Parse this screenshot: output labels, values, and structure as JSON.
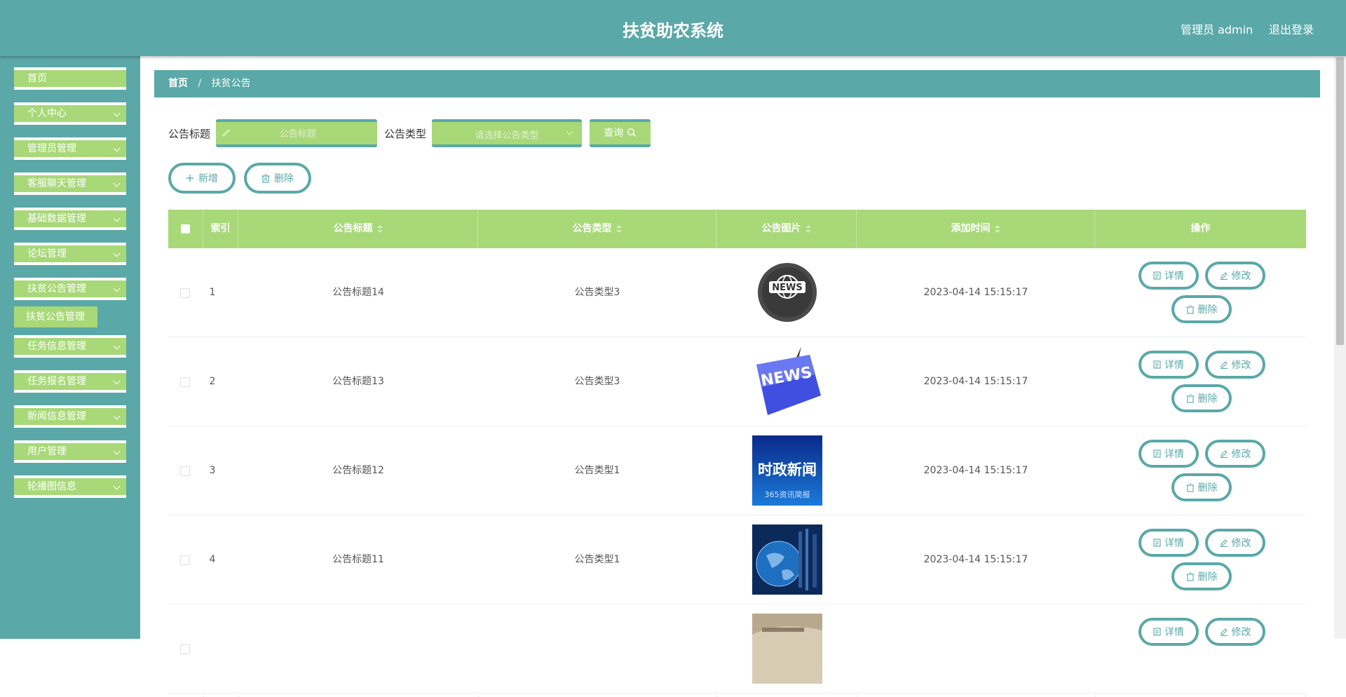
{
  "header": {
    "title": "扶贫助农系统",
    "user": "管理员 admin",
    "logout": "退出登录"
  },
  "sidebar": {
    "items": [
      {
        "label": "首页"
      },
      {
        "label": "个人中心"
      },
      {
        "label": "管理员管理"
      },
      {
        "label": "客服聊天管理"
      },
      {
        "label": "基础数据管理"
      },
      {
        "label": "论坛管理"
      },
      {
        "label": "扶贫公告管理"
      },
      {
        "label": "任务信息管理"
      },
      {
        "label": "任务报名管理"
      },
      {
        "label": "新闻信息管理"
      },
      {
        "label": "用户管理"
      },
      {
        "label": "轮播图信息"
      }
    ],
    "submenu": {
      "label": "扶贫公告管理"
    }
  },
  "breadcrumb": {
    "home": "首页",
    "separator": "/",
    "current": "扶贫公告"
  },
  "search": {
    "title_label": "公告标题",
    "title_placeholder": "公告标题",
    "type_label": "公告类型",
    "type_placeholder": "请选择公告类型",
    "query_label": "查询"
  },
  "actions": {
    "add_label": "新增",
    "delete_label": "删除"
  },
  "table": {
    "columns": [
      "索引",
      "公告标题",
      "公告类型",
      "公告图片",
      "添加时间",
      "操作"
    ],
    "row_actions": {
      "detail": "详情",
      "edit": "修改",
      "delete": "删除"
    },
    "rows": [
      {
        "index": "1",
        "title": "公告标题14",
        "type": "公告类型3",
        "image_text": "NEWS",
        "time": "2023-04-14 15:15:17"
      },
      {
        "index": "2",
        "title": "公告标题13",
        "type": "公告类型3",
        "image_text": "NEWS",
        "time": "2023-04-14 15:15:17"
      },
      {
        "index": "3",
        "title": "公告标题12",
        "type": "公告类型1",
        "image_text": "时政新闻",
        "image_subtext": "365资讯简报",
        "time": "2023-04-14 15:15:17"
      },
      {
        "index": "4",
        "title": "公告标题11",
        "type": "公告类型1",
        "time": "2023-04-14 15:15:17"
      },
      {
        "index": "",
        "title": "",
        "type": "",
        "time": ""
      }
    ]
  },
  "colors": {
    "teal": "#5ba8a8",
    "green": "#a8d878",
    "white": "#ffffff"
  }
}
